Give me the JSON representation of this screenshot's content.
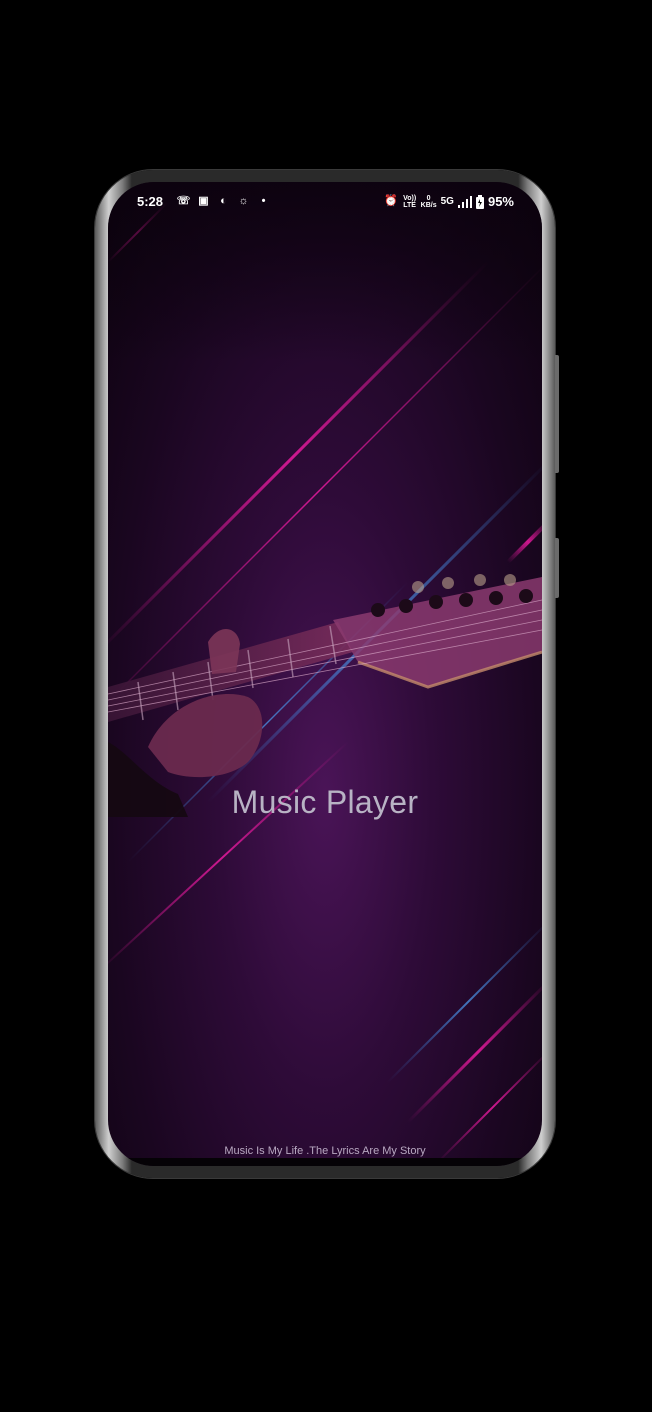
{
  "status_bar": {
    "time": "5:28",
    "left_icons": [
      "whatsapp-icon",
      "instagram-icon",
      "app-icon",
      "snapchat-icon",
      "dot-icon"
    ],
    "right_icons": [
      "alarm-icon",
      "volte-icon",
      "data-speed-icon",
      "5g-icon",
      "signal-icon",
      "battery-icon"
    ],
    "volte_label": "Vo)) LTE",
    "speed_value": "0",
    "speed_unit": "KB/s",
    "network": "5G",
    "battery": "95%"
  },
  "app": {
    "title": "Music Player",
    "tagline": "Music Is My Life .The Lyrics Are My Story"
  },
  "colors": {
    "background": "#000000",
    "screen_bg": "#2e0b38",
    "accent_pink": "#e0199a",
    "accent_blue": "#3a7bd5",
    "title_text": "#b8b3c4"
  }
}
